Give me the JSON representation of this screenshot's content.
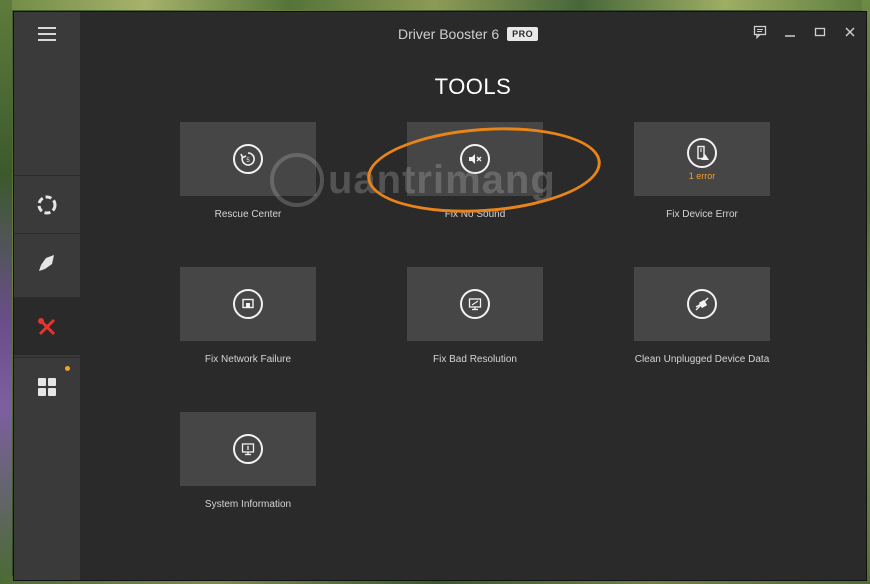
{
  "app": {
    "title": "Driver Booster 6",
    "badge": "PRO"
  },
  "page": {
    "title": "TOOLS"
  },
  "sidebar": {
    "items": [
      {
        "name": "scan",
        "icon": "scan-ring-icon"
      },
      {
        "name": "boost",
        "icon": "rocket-icon"
      },
      {
        "name": "tools",
        "icon": "tools-icon",
        "active": true,
        "accent": "#e8332d"
      },
      {
        "name": "action-center",
        "icon": "grid-icon",
        "notification": true
      }
    ]
  },
  "tools": [
    {
      "label": "Rescue Center",
      "icon": "restore-icon"
    },
    {
      "label": "Fix No Sound",
      "icon": "mute-icon"
    },
    {
      "label": "Fix Device Error",
      "icon": "device-error-icon",
      "status": "1 error"
    },
    {
      "label": "Fix Network Failure",
      "icon": "network-icon"
    },
    {
      "label": "Fix Bad Resolution",
      "icon": "resolution-icon"
    },
    {
      "label": "Clean Unplugged Device Data",
      "icon": "unplugged-icon"
    },
    {
      "label": "System Information",
      "icon": "system-info-icon"
    }
  ],
  "watermark": {
    "text": "uantrimang"
  },
  "colors": {
    "background": "#2a2a2a",
    "sidebar": "#3a3a3a",
    "tile": "#464646",
    "highlight": "#e8841a",
    "error": "#f39c2d",
    "active": "#e8332d"
  }
}
